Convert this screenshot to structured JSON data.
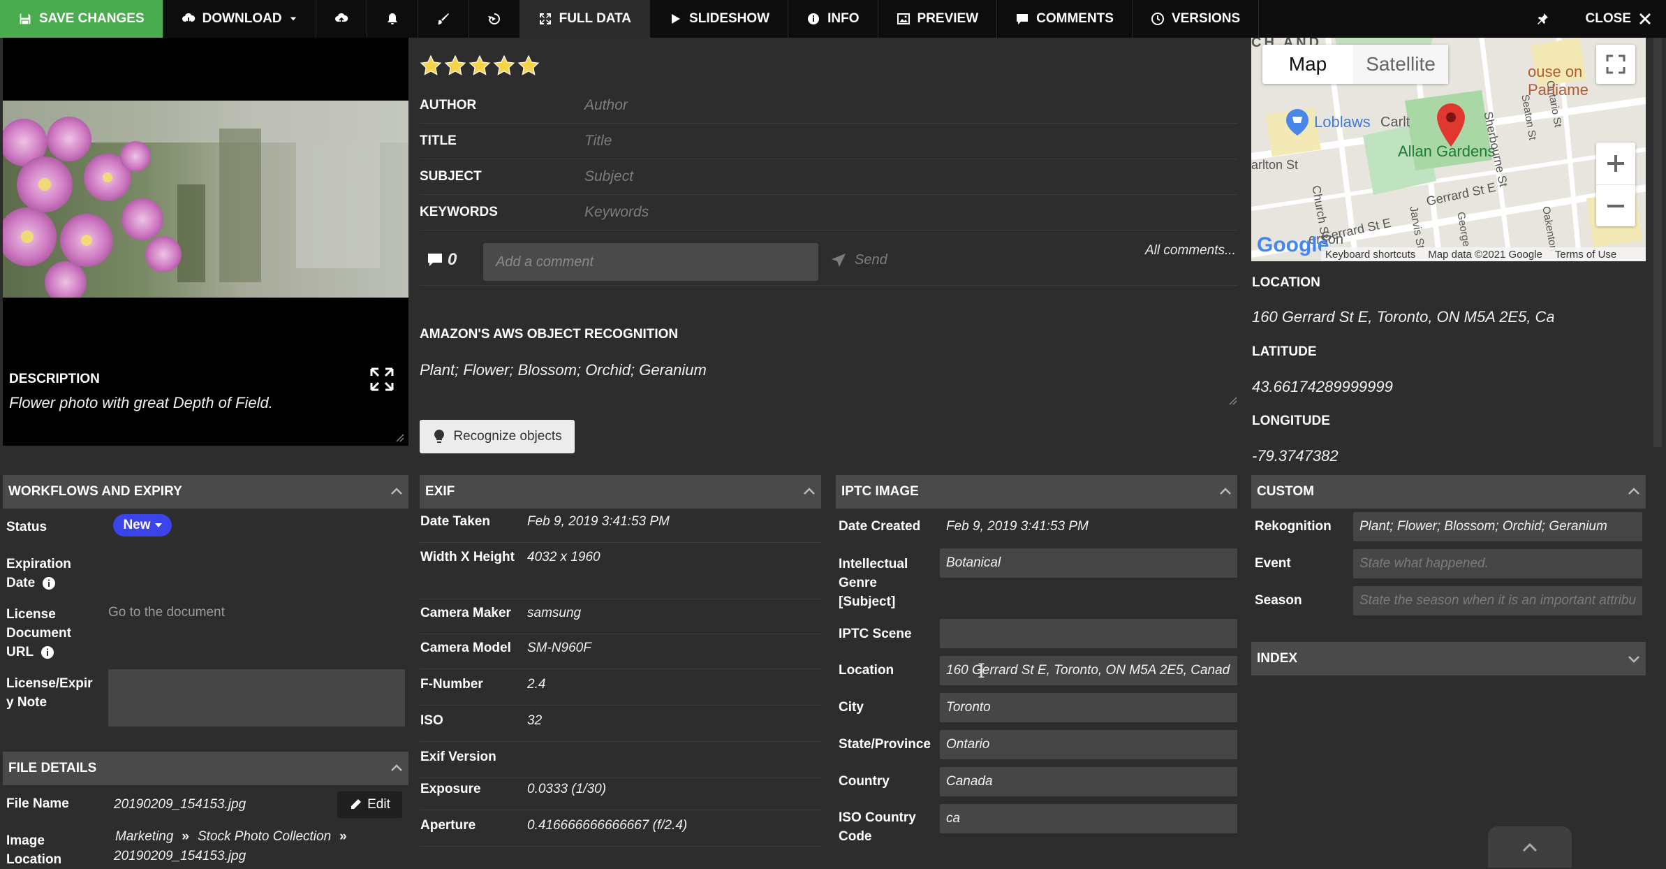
{
  "toolbar": {
    "save": "SAVE CHANGES",
    "download": "DOWNLOAD",
    "full_data": "FULL DATA",
    "slideshow": "SLIDESHOW",
    "info": "INFO",
    "preview": "PREVIEW",
    "comments": "COMMENTS",
    "versions": "VERSIONS",
    "close": "CLOSE"
  },
  "description": {
    "label": "DESCRIPTION",
    "value": "Flower photo with great Depth of Field."
  },
  "rating": {
    "stars": 5,
    "max": 5
  },
  "metadata": {
    "author": {
      "label": "AUTHOR",
      "placeholder": "Author"
    },
    "title": {
      "label": "TITLE",
      "placeholder": "Title"
    },
    "subject": {
      "label": "SUBJECT",
      "placeholder": "Subject"
    },
    "keywords": {
      "label": "KEYWORDS",
      "placeholder": "Keywords"
    }
  },
  "comments": {
    "count": "0",
    "placeholder": "Add a comment",
    "send": "Send",
    "all": "All comments..."
  },
  "aws": {
    "label": "AMAZON'S AWS OBJECT RECOGNITION",
    "value": "Plant; Flower; Blossom; Orchid; Geranium",
    "button": "Recognize objects"
  },
  "map": {
    "tab_map": "Map",
    "tab_satellite": "Satellite",
    "labels": {
      "loblaws": "Loblaws",
      "allan": "Allan Gardens",
      "carlton": "Carlt",
      "house": "ouse on Parliame",
      "arlton": "arlton St",
      "church": "Church St",
      "sherbourne": "Sherbourne St",
      "gerrard1": "Gerrard St E",
      "gerrard2": "Gerrard St E",
      "jarvis": "Jarvis St",
      "seaton": "Seaton St",
      "ontario": "Ontario St",
      "george": "George St",
      "okenton": "Oakenton",
      "cnand": "CH AND",
      "erson": "erson"
    },
    "google": "Google",
    "footer": {
      "shortcuts": "Keyboard shortcuts",
      "data": "Map data ©2021 Google",
      "terms": "Terms of Use"
    }
  },
  "location": {
    "location_label": "LOCATION",
    "location_value": "160 Gerrard St E, Toronto, ON M5A 2E5, Ca",
    "latitude_label": "LATITUDE",
    "latitude_value": "43.66174289999999",
    "longitude_label": "LONGITUDE",
    "longitude_value": "-79.3747382"
  },
  "workflows": {
    "title": "WORKFLOWS AND EXPIRY",
    "status_label": "Status",
    "status_value": "New",
    "expiration_label_1": "Expiration",
    "expiration_label_2": "Date",
    "license_label_1": "License",
    "license_label_2": "Document",
    "license_label_3": "URL",
    "license_link": "Go to the document",
    "note_label_1": "License/Expir",
    "note_label_2": "y Note"
  },
  "file_details": {
    "title": "FILE DETAILS",
    "file_name_label": "File Name",
    "file_name": "20190209_154153.jpg",
    "edit": "Edit",
    "image_location_label_1": "Image",
    "image_location_label_2": "Location",
    "crumb1": "Marketing",
    "crumb2": "Stock Photo Collection",
    "crumb3": "20190209_154153.jpg"
  },
  "exif": {
    "title": "EXIF",
    "rows": [
      {
        "label": "Date Taken",
        "value": "Feb 9, 2019 3:41:53 PM"
      },
      {
        "label": "Width X Height",
        "value": "4032 x 1960"
      },
      {
        "label": "Camera Maker",
        "value": "samsung"
      },
      {
        "label": "Camera Model",
        "value": "SM-N960F"
      },
      {
        "label": "F-Number",
        "value": "2.4"
      },
      {
        "label": "ISO",
        "value": "32"
      },
      {
        "label": "Exif Version",
        "value": ""
      },
      {
        "label": "Exposure",
        "value": "0.0333 (1/30)"
      },
      {
        "label": "Aperture",
        "value": "0.416666666666667 (f/2.4)"
      }
    ]
  },
  "iptc": {
    "title": "IPTC IMAGE",
    "date_created_label": "Date Created",
    "date_created": "Feb 9, 2019 3:41:53 PM",
    "genre_label_1": "Intellectual",
    "genre_label_2": "Genre",
    "genre_label_3": "[Subject]",
    "genre": "Botanical",
    "scene_label": "IPTC Scene",
    "scene": "",
    "location_label": "Location",
    "location": "160 Gerrard St E, Toronto, ON M5A 2E5, Canad",
    "city_label": "City",
    "city": "Toronto",
    "state_label": "State/Province",
    "state": "Ontario",
    "country_label": "Country",
    "country": "Canada",
    "iso_label_1": "ISO Country",
    "iso_label_2": "Code",
    "iso": "ca"
  },
  "custom": {
    "title": "CUSTOM",
    "rekognition_label": "Rekognition",
    "rekognition": "Plant; Flower; Blossom; Orchid; Geranium",
    "event_label": "Event",
    "event_placeholder": "State what happened.",
    "season_label": "Season",
    "season_placeholder": "State the season when it is an important attribu"
  },
  "index": {
    "title": "INDEX"
  },
  "colors": {
    "save": "#4bab4f",
    "status": "#3a44e8",
    "toolbar": "#0d0d0d",
    "panel": "#4a4a4a"
  }
}
